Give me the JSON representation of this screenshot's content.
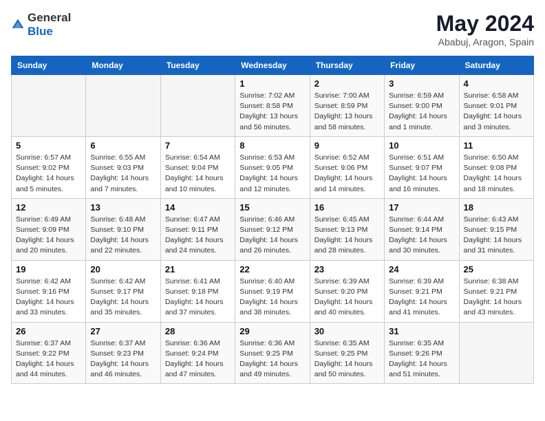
{
  "header": {
    "logo_general": "General",
    "logo_blue": "Blue",
    "month_title": "May 2024",
    "location": "Ababuj, Aragon, Spain"
  },
  "weekdays": [
    "Sunday",
    "Monday",
    "Tuesday",
    "Wednesday",
    "Thursday",
    "Friday",
    "Saturday"
  ],
  "weeks": [
    [
      null,
      null,
      null,
      {
        "day": 1,
        "sunrise": "7:02 AM",
        "sunset": "8:58 PM",
        "daylight": "13 hours and 56 minutes."
      },
      {
        "day": 2,
        "sunrise": "7:00 AM",
        "sunset": "8:59 PM",
        "daylight": "13 hours and 58 minutes."
      },
      {
        "day": 3,
        "sunrise": "6:59 AM",
        "sunset": "9:00 PM",
        "daylight": "14 hours and 1 minute."
      },
      {
        "day": 4,
        "sunrise": "6:58 AM",
        "sunset": "9:01 PM",
        "daylight": "14 hours and 3 minutes."
      }
    ],
    [
      {
        "day": 5,
        "sunrise": "6:57 AM",
        "sunset": "9:02 PM",
        "daylight": "14 hours and 5 minutes."
      },
      {
        "day": 6,
        "sunrise": "6:55 AM",
        "sunset": "9:03 PM",
        "daylight": "14 hours and 7 minutes."
      },
      {
        "day": 7,
        "sunrise": "6:54 AM",
        "sunset": "9:04 PM",
        "daylight": "14 hours and 10 minutes."
      },
      {
        "day": 8,
        "sunrise": "6:53 AM",
        "sunset": "9:05 PM",
        "daylight": "14 hours and 12 minutes."
      },
      {
        "day": 9,
        "sunrise": "6:52 AM",
        "sunset": "9:06 PM",
        "daylight": "14 hours and 14 minutes."
      },
      {
        "day": 10,
        "sunrise": "6:51 AM",
        "sunset": "9:07 PM",
        "daylight": "14 hours and 16 minutes."
      },
      {
        "day": 11,
        "sunrise": "6:50 AM",
        "sunset": "9:08 PM",
        "daylight": "14 hours and 18 minutes."
      }
    ],
    [
      {
        "day": 12,
        "sunrise": "6:49 AM",
        "sunset": "9:09 PM",
        "daylight": "14 hours and 20 minutes."
      },
      {
        "day": 13,
        "sunrise": "6:48 AM",
        "sunset": "9:10 PM",
        "daylight": "14 hours and 22 minutes."
      },
      {
        "day": 14,
        "sunrise": "6:47 AM",
        "sunset": "9:11 PM",
        "daylight": "14 hours and 24 minutes."
      },
      {
        "day": 15,
        "sunrise": "6:46 AM",
        "sunset": "9:12 PM",
        "daylight": "14 hours and 26 minutes."
      },
      {
        "day": 16,
        "sunrise": "6:45 AM",
        "sunset": "9:13 PM",
        "daylight": "14 hours and 28 minutes."
      },
      {
        "day": 17,
        "sunrise": "6:44 AM",
        "sunset": "9:14 PM",
        "daylight": "14 hours and 30 minutes."
      },
      {
        "day": 18,
        "sunrise": "6:43 AM",
        "sunset": "9:15 PM",
        "daylight": "14 hours and 31 minutes."
      }
    ],
    [
      {
        "day": 19,
        "sunrise": "6:42 AM",
        "sunset": "9:16 PM",
        "daylight": "14 hours and 33 minutes."
      },
      {
        "day": 20,
        "sunrise": "6:42 AM",
        "sunset": "9:17 PM",
        "daylight": "14 hours and 35 minutes."
      },
      {
        "day": 21,
        "sunrise": "6:41 AM",
        "sunset": "9:18 PM",
        "daylight": "14 hours and 37 minutes."
      },
      {
        "day": 22,
        "sunrise": "6:40 AM",
        "sunset": "9:19 PM",
        "daylight": "14 hours and 38 minutes."
      },
      {
        "day": 23,
        "sunrise": "6:39 AM",
        "sunset": "9:20 PM",
        "daylight": "14 hours and 40 minutes."
      },
      {
        "day": 24,
        "sunrise": "6:39 AM",
        "sunset": "9:21 PM",
        "daylight": "14 hours and 41 minutes."
      },
      {
        "day": 25,
        "sunrise": "6:38 AM",
        "sunset": "9:21 PM",
        "daylight": "14 hours and 43 minutes."
      }
    ],
    [
      {
        "day": 26,
        "sunrise": "6:37 AM",
        "sunset": "9:22 PM",
        "daylight": "14 hours and 44 minutes."
      },
      {
        "day": 27,
        "sunrise": "6:37 AM",
        "sunset": "9:23 PM",
        "daylight": "14 hours and 46 minutes."
      },
      {
        "day": 28,
        "sunrise": "6:36 AM",
        "sunset": "9:24 PM",
        "daylight": "14 hours and 47 minutes."
      },
      {
        "day": 29,
        "sunrise": "6:36 AM",
        "sunset": "9:25 PM",
        "daylight": "14 hours and 49 minutes."
      },
      {
        "day": 30,
        "sunrise": "6:35 AM",
        "sunset": "9:25 PM",
        "daylight": "14 hours and 50 minutes."
      },
      {
        "day": 31,
        "sunrise": "6:35 AM",
        "sunset": "9:26 PM",
        "daylight": "14 hours and 51 minutes."
      },
      null
    ]
  ],
  "labels": {
    "sunrise": "Sunrise:",
    "sunset": "Sunset:",
    "daylight": "Daylight hours"
  }
}
